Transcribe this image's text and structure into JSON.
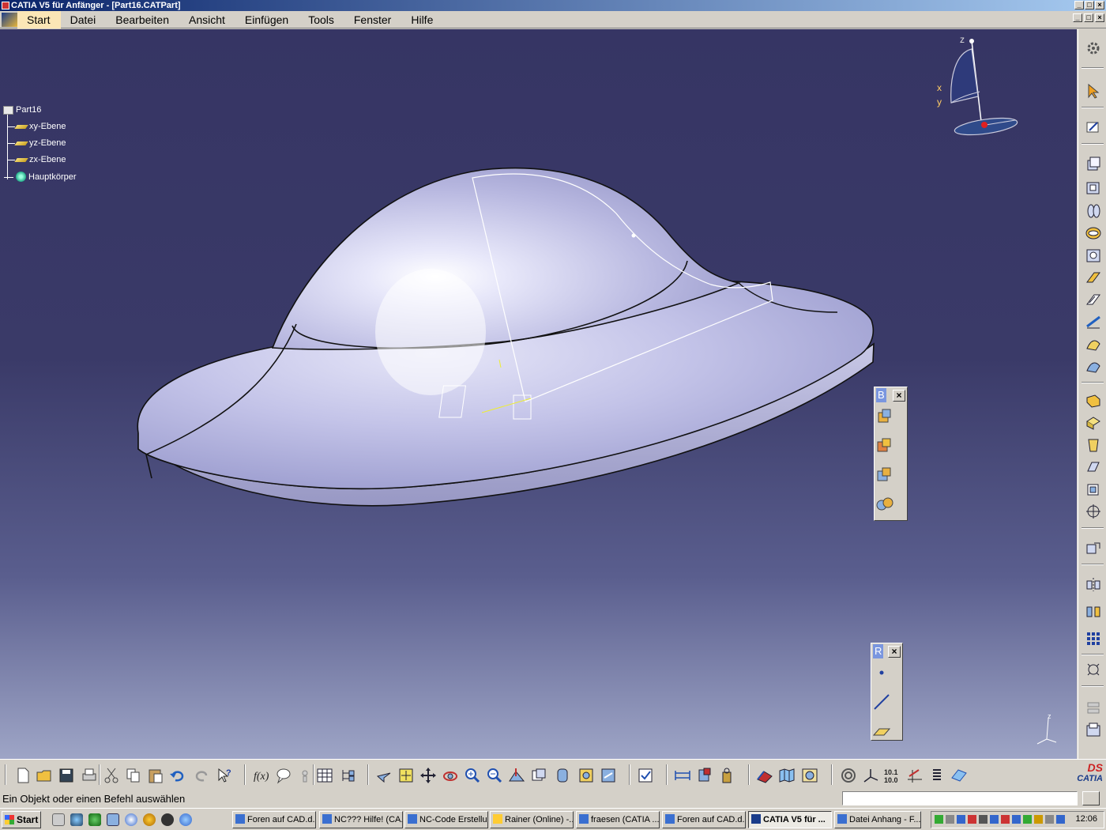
{
  "window": {
    "title": "CATIA V5 für Anfänger - [Part16.CATPart]",
    "controls": [
      "_",
      "□",
      "×"
    ]
  },
  "menu": {
    "items": [
      {
        "label": "Start",
        "active": true
      },
      {
        "label": "Datei"
      },
      {
        "label": "Bearbeiten"
      },
      {
        "label": "Ansicht"
      },
      {
        "label": "Einfügen"
      },
      {
        "label": "Tools"
      },
      {
        "label": "Fenster"
      },
      {
        "label": "Hilfe"
      }
    ]
  },
  "tree": {
    "root": "Part16",
    "planes": [
      "xy-Ebene",
      "yz-Ebene",
      "zx-Ebene"
    ],
    "body": "Hauptkörper"
  },
  "compass": {
    "x": "x",
    "y": "y",
    "z": "z"
  },
  "corner_axis": {
    "z": "z"
  },
  "floating_toolbars": {
    "boolean": {
      "title": "B",
      "close": "×"
    },
    "reference": {
      "title": "R",
      "close": "×"
    }
  },
  "status": {
    "message": "Ein Objekt oder einen Befehl auswählen"
  },
  "catia_logo": {
    "ds": "DS",
    "name": "CATIA"
  },
  "taskbar": {
    "start": "Start",
    "tasks": [
      {
        "label": "Foren auf CAD.d..."
      },
      {
        "label": "NC??? Hilfe! (CA..."
      },
      {
        "label": "NC-Code Erstellu..."
      },
      {
        "label": "Rainer (Online) -..."
      },
      {
        "label": "fraesen (CATIA ..."
      },
      {
        "label": "Foren auf CAD.d..."
      },
      {
        "label": "CATIA V5 für ...",
        "active": true
      },
      {
        "label": "Datei Anhang - F..."
      }
    ],
    "clock": "12:06"
  },
  "colors": {
    "viewport_top": "#363564",
    "viewport_bottom": "#9ea5c6",
    "part_fill": "#c6c6ea",
    "menu_active": "#fbe6b6"
  }
}
